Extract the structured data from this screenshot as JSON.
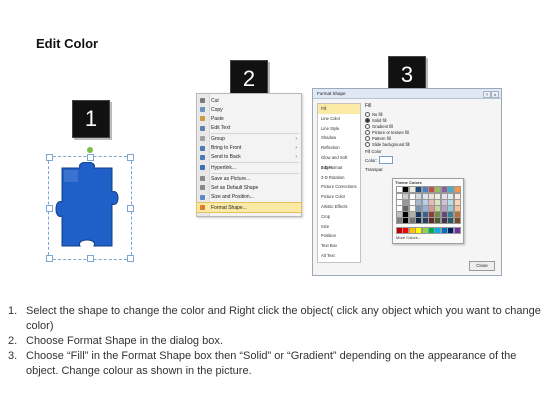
{
  "title": "Edit Color",
  "badges": [
    "1",
    "2",
    "3"
  ],
  "shape": {
    "fill": "#1f5fc8",
    "stroke": "#133e86"
  },
  "context_menu": {
    "items": [
      {
        "label": "Cut",
        "color": "#7a7a7a",
        "arrow": ""
      },
      {
        "label": "Copy",
        "color": "#6a8fbf",
        "arrow": ""
      },
      {
        "label": "Paste",
        "color": "#c99a3e",
        "arrow": ""
      },
      {
        "label": "Edit Text",
        "color": "#5c7fae",
        "arrow": ""
      },
      {
        "label": "Group",
        "color": "#9aa0a6",
        "arrow": "›"
      },
      {
        "label": "Bring to Front",
        "color": "#4a79b8",
        "arrow": "›"
      },
      {
        "label": "Send to Back",
        "color": "#4a79b8",
        "arrow": "›"
      },
      {
        "label": "Hyperlink...",
        "color": "#3b6fb5",
        "arrow": ""
      },
      {
        "label": "Save as Picture...",
        "color": "#888888",
        "arrow": ""
      },
      {
        "label": "Set as Default Shape",
        "color": "#888888",
        "arrow": ""
      },
      {
        "label": "Size and Position...",
        "color": "#5b88c4",
        "arrow": ""
      },
      {
        "label": "Format Shape...",
        "color": "#e07b2a",
        "arrow": ""
      }
    ]
  },
  "dialog": {
    "title": "Format Shape",
    "title_buttons": [
      "?",
      "x"
    ],
    "categories": [
      "Fill",
      "Line Color",
      "Line Style",
      "Shadow",
      "Reflection",
      "Glow and Soft Edges",
      "3-D Format",
      "3-D Rotation",
      "Picture Corrections",
      "Picture Color",
      "Artistic Effects",
      "Crop",
      "Size",
      "Position",
      "Text Box",
      "Alt Text"
    ],
    "selected_category": "Fill",
    "fill_heading": "Fill",
    "fill_options": [
      {
        "label": "No fill",
        "on": false
      },
      {
        "label": "Solid fill",
        "on": true
      },
      {
        "label": "Gradient fill",
        "on": false
      },
      {
        "label": "Picture or texture fill",
        "on": false
      },
      {
        "label": "Pattern fill",
        "on": false
      },
      {
        "label": "Slide background fill",
        "on": false
      }
    ],
    "fill_color_heading": "Fill Color",
    "color_label": "Color:",
    "transparency_label": "Transpar",
    "palette_header": "Theme Colors",
    "more_colors": "More Colors...",
    "close_label": "Close",
    "theme_colors": [
      "#ffffff",
      "#000000",
      "#eeece1",
      "#1f497d",
      "#4f81bd",
      "#c0504d",
      "#9bbb59",
      "#8064a2",
      "#4bacc6",
      "#f79646"
    ],
    "standard_colors": [
      "#c00000",
      "#ff0000",
      "#ffc000",
      "#ffff00",
      "#92d050",
      "#00b050",
      "#00b0f0",
      "#0070c0",
      "#002060",
      "#7030a0"
    ]
  },
  "instructions": [
    {
      "num": "1.",
      "text": "Select the shape to change the color and Right click the object( click any object which you want to change color)"
    },
    {
      "num": "2.",
      "text": "Choose Format Shape in the dialog box."
    },
    {
      "num": "3.",
      "text": "Choose “Fill” in the Format Shape box then “Solid” or “Gradient” depending on the appearance of the object. Change colour as shown in the picture."
    }
  ]
}
